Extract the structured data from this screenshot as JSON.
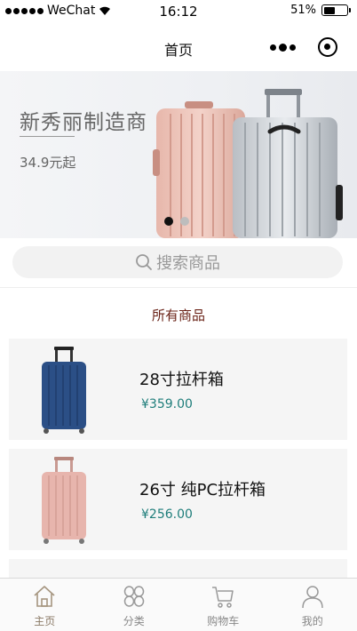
{
  "status_bar": {
    "carrier": "WeChat",
    "time": "16:12",
    "battery": "51%",
    "battery_level": 0.51
  },
  "nav": {
    "title": "首页"
  },
  "banner": {
    "title": "新秀丽制造商",
    "price": "34.9元起",
    "slides": 2,
    "active_slide": 0
  },
  "search": {
    "placeholder": "搜索商品"
  },
  "section": {
    "title": "所有商品"
  },
  "products": [
    {
      "name": "28寸拉杆箱",
      "price": "¥359.00",
      "color": "#2b4f86"
    },
    {
      "name": "26寸 纯PC拉杆箱",
      "price": "¥256.00",
      "color": "#e7b5ad"
    }
  ],
  "tabs": [
    {
      "label": "主页",
      "icon": "home-icon",
      "active": true
    },
    {
      "label": "分类",
      "icon": "category-icon",
      "active": false
    },
    {
      "label": "购物车",
      "icon": "cart-icon",
      "active": false
    },
    {
      "label": "我的",
      "icon": "profile-icon",
      "active": false
    }
  ],
  "colors": {
    "accent_price": "#1e7d7a",
    "section_title": "#6b2419",
    "tab_active": "#8a7a66"
  }
}
